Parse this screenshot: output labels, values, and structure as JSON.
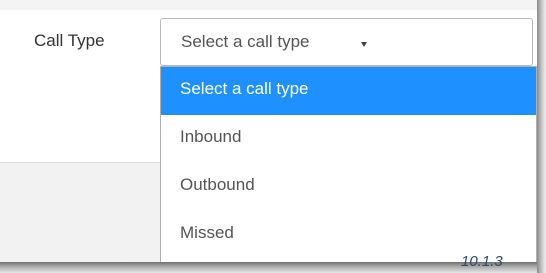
{
  "form": {
    "call_type_label": "Call Type",
    "select_value": "Select a call type"
  },
  "dropdown": {
    "options": [
      {
        "label": "Select a call type",
        "selected": true
      },
      {
        "label": "Inbound",
        "selected": false
      },
      {
        "label": "Outbound",
        "selected": false
      },
      {
        "label": "Missed",
        "selected": false
      }
    ]
  },
  "version": "10.1.3",
  "colors": {
    "highlight": "#1e90ff",
    "text": "#555555",
    "label": "#333333",
    "version_text": "#2e4a6b"
  }
}
